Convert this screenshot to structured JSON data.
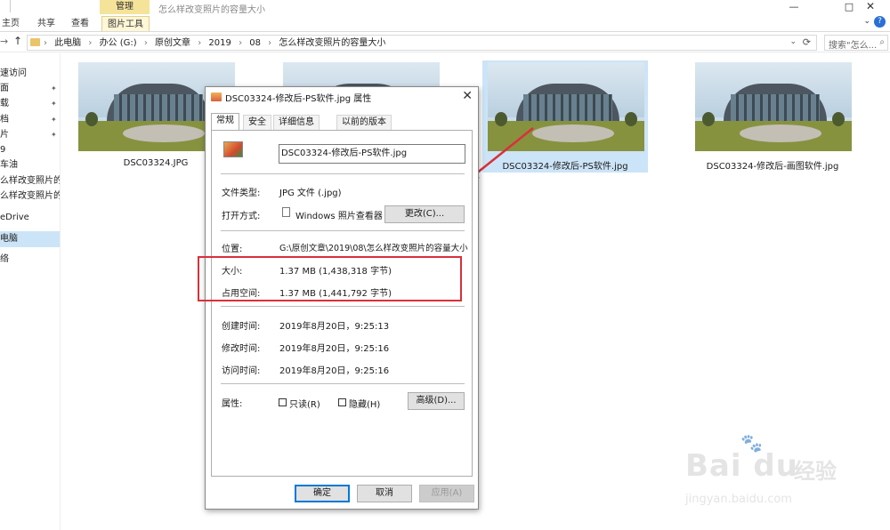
{
  "window": {
    "title": "怎么样改变照片的容量大小",
    "manage_tab": "管理",
    "controls": {
      "minimize": "—",
      "maximize": "□",
      "close": "✕"
    }
  },
  "ribbon": {
    "tabs": [
      "主页",
      "共享",
      "查看",
      "图片工具"
    ],
    "expand": "⌄",
    "help": "?"
  },
  "address": {
    "back": "←",
    "forward": "→",
    "up": "↑",
    "crumbs": [
      "此电脑",
      "办公 (G:)",
      "原创文章",
      "2019",
      "08",
      "怎么样改变照片的容量大小"
    ],
    "separator": "›",
    "dropdown": "⌄",
    "refresh": "⟳",
    "search_placeholder": "搜索\"怎么..."
  },
  "sidebar": {
    "items": [
      {
        "label": "速访问",
        "pinned": false
      },
      {
        "label": "面",
        "pinned": true
      },
      {
        "label": "载",
        "pinned": true
      },
      {
        "label": "档",
        "pinned": true
      },
      {
        "label": "片",
        "pinned": true
      },
      {
        "label": "9",
        "pinned": false
      },
      {
        "label": "车油",
        "pinned": false
      },
      {
        "label": "么样改变照片的容",
        "pinned": false
      },
      {
        "label": "么样改变照片的容",
        "pinned": false
      },
      {
        "label": "eDrive",
        "pinned": false
      },
      {
        "label": "电脑",
        "pinned": false,
        "selected": true
      },
      {
        "label": "络",
        "pinned": false
      }
    ],
    "pin_glyph": "📌"
  },
  "files": [
    {
      "name": "DSC03324.JPG",
      "selected": false
    },
    {
      "name": "",
      "selected": false
    },
    {
      "name": "DSC03324-修改后-PS软件.jpg",
      "selected": true
    },
    {
      "name": "DSC03324-修改后-画图软件.jpg",
      "selected": false
    }
  ],
  "dialog": {
    "title": "DSC03324-修改后-PS软件.jpg 属性",
    "close": "✕",
    "tabs": [
      "常规",
      "安全",
      "详细信息",
      "以前的版本"
    ],
    "active_tab": "常规",
    "filename": "DSC03324-修改后-PS软件.jpg",
    "file_type_label": "文件类型:",
    "file_type": "JPG 文件 (.jpg)",
    "opens_with_label": "打开方式:",
    "opens_with": "Windows 照片查看器",
    "change_button": "更改(C)...",
    "location_label": "位置:",
    "location": "G:\\原创文章\\2019\\08\\怎么样改变照片的容量大小",
    "size_label": "大小:",
    "size": "1.37 MB (1,438,318 字节)",
    "size_on_disk_label": "占用空间:",
    "size_on_disk": "1.37 MB (1,441,792 字节)",
    "created_label": "创建时间:",
    "created": "2019年8月20日，9:25:13",
    "modified_label": "修改时间:",
    "modified": "2019年8月20日，9:25:16",
    "accessed_label": "访问时间:",
    "accessed": "2019年8月20日，9:25:16",
    "attributes_label": "属性:",
    "readonly_label": "只读(R)",
    "readonly_checked": false,
    "hidden_label": "隐藏(H)",
    "hidden_checked": false,
    "advanced_button": "高级(D)...",
    "ok_button": "确定",
    "cancel_button": "取消",
    "apply_button": "应用(A)"
  },
  "annotation": {
    "highlight_color": "#d9303a"
  },
  "watermark": {
    "logo_text": "Bai  du",
    "paw": "🐾",
    "cn": "经验",
    "url": "jingyan.baidu.com"
  },
  "colors": {
    "selection": "#cce4f7",
    "manage_tab": "#f6e39a",
    "accent": "#0078d7"
  }
}
